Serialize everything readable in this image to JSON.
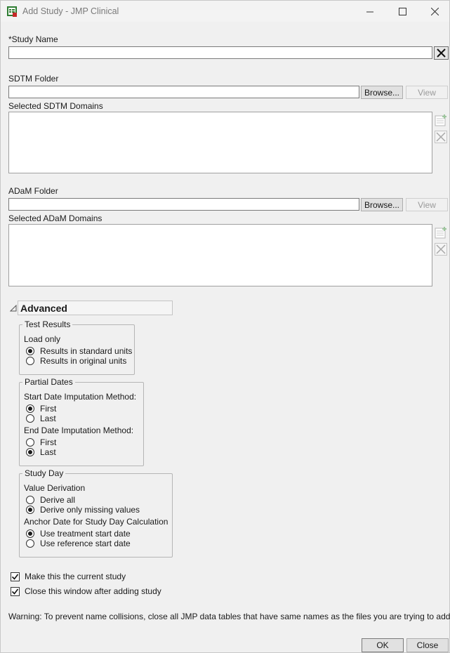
{
  "window": {
    "title": "Add Study - JMP Clinical"
  },
  "study_name": {
    "label": "*Study Name",
    "value": ""
  },
  "sdtm": {
    "folder_label": "SDTM Folder",
    "folder_value": "",
    "browse_label": "Browse...",
    "view_label": "View",
    "domains_label": "Selected SDTM Domains"
  },
  "adam": {
    "folder_label": "ADaM Folder",
    "folder_value": "",
    "browse_label": "Browse...",
    "view_label": "View",
    "domains_label": "Selected ADaM Domains"
  },
  "advanced": {
    "title": "Advanced",
    "test_results": {
      "title": "Test Results",
      "load_only_label": "Load only",
      "options": [
        "Results in standard units",
        "Results in original units"
      ],
      "selected": 0
    },
    "partial_dates": {
      "title": "Partial Dates",
      "start_label": "Start Date Imputation Method:",
      "start_options": [
        "First",
        "Last"
      ],
      "start_selected": 0,
      "end_label": "End Date Imputation Method:",
      "end_options": [
        "First",
        "Last"
      ],
      "end_selected": 1
    },
    "study_day": {
      "title": "Study Day",
      "value_derivation_label": "Value Derivation",
      "derivation_options": [
        "Derive all",
        "Derive only missing values"
      ],
      "derivation_selected": 1,
      "anchor_label": "Anchor Date for Study Day Calculation",
      "anchor_options": [
        "Use treatment start date",
        "Use reference start date"
      ],
      "anchor_selected": 0
    }
  },
  "checkboxes": {
    "make_current": {
      "label": "Make this the current study",
      "checked": true
    },
    "close_after": {
      "label": "Close this window after adding study",
      "checked": true
    }
  },
  "warning": "Warning: To prevent name collisions, close all JMP data tables that have same names as the files you are trying to add.",
  "footer": {
    "ok_label": "OK",
    "close_label": "Close"
  }
}
